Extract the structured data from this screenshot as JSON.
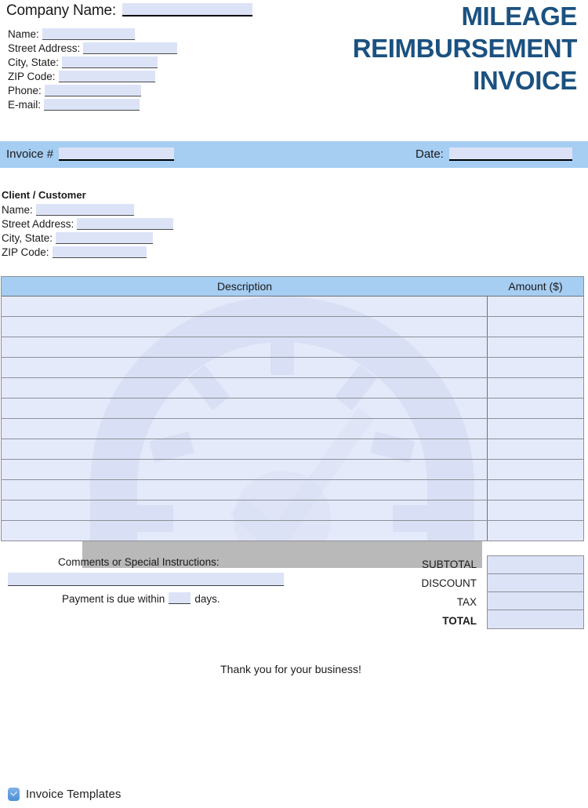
{
  "document": {
    "title_lines": [
      "MILEAGE",
      "REIMBURSEMENT",
      "INVOICE"
    ],
    "title_color": "#1b5180",
    "band_color": "#a6cdf2",
    "field_fill_color": "#dde3f7"
  },
  "company": {
    "title_label": "Company Name:",
    "title_value": "",
    "fields": [
      {
        "label": "Name:",
        "value": "",
        "fill_width": 118
      },
      {
        "label": "Street Address:",
        "value": "",
        "fill_width": 120
      },
      {
        "label": "City, State:",
        "value": "",
        "fill_width": 122
      },
      {
        "label": "ZIP Code:",
        "value": "",
        "fill_width": 123
      },
      {
        "label": "Phone:",
        "value": "",
        "fill_width": 123
      },
      {
        "label": "E-mail:",
        "value": "",
        "fill_width": 122
      }
    ]
  },
  "band": {
    "invoice_label": "Invoice #",
    "invoice_value": "",
    "invoice_fill_width": 147,
    "date_label": "Date:",
    "date_value": "",
    "date_fill_width": 157
  },
  "client": {
    "heading": "Client / Customer",
    "fields": [
      {
        "label": "Name:",
        "value": "",
        "fill_width": 125
      },
      {
        "label": "Street Address:",
        "value": "",
        "fill_width": 123
      },
      {
        "label": "City, State:",
        "value": "",
        "fill_width": 124
      },
      {
        "label": "ZIP Code:",
        "value": "",
        "fill_width": 120
      }
    ]
  },
  "items_table": {
    "columns": [
      "Description",
      "Amount ($)"
    ],
    "rows": [
      {
        "description": "",
        "amount": ""
      },
      {
        "description": "",
        "amount": ""
      },
      {
        "description": "",
        "amount": ""
      },
      {
        "description": "",
        "amount": ""
      },
      {
        "description": "",
        "amount": ""
      },
      {
        "description": "",
        "amount": ""
      },
      {
        "description": "",
        "amount": ""
      },
      {
        "description": "",
        "amount": ""
      },
      {
        "description": "",
        "amount": ""
      },
      {
        "description": "",
        "amount": ""
      },
      {
        "description": "",
        "amount": ""
      },
      {
        "description": "",
        "amount": ""
      }
    ]
  },
  "comments": {
    "label": "Comments or Special Instructions:",
    "value": "",
    "due_prefix": "Payment is due within",
    "due_days": "",
    "due_suffix": "days."
  },
  "totals": {
    "rows": [
      {
        "label": "SUBTOTAL",
        "value": "",
        "bold": false
      },
      {
        "label": "DISCOUNT",
        "value": "",
        "bold": false
      },
      {
        "label": "TAX",
        "value": "",
        "bold": false
      },
      {
        "label": "TOTAL",
        "value": "",
        "bold": true
      }
    ]
  },
  "closing": {
    "thanks": "Thank you for your business!"
  },
  "footer": {
    "brand": "Invoice Templates",
    "icon": "check-badge-icon"
  },
  "watermark": {
    "icon": "speedometer-check-icon",
    "color": "#c9cfe3"
  }
}
